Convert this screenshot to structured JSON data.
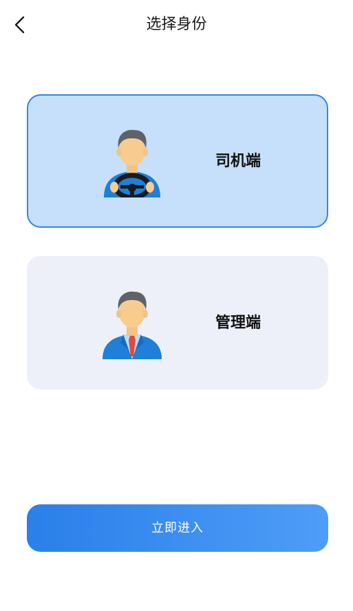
{
  "header": {
    "title": "选择身份",
    "back_icon": "chevron-left-icon"
  },
  "roles": [
    {
      "label": "司机端",
      "icon": "driver-avatar-icon",
      "selected": true
    },
    {
      "label": "管理端",
      "icon": "manager-avatar-icon",
      "selected": false
    }
  ],
  "actions": {
    "enter_label": "立即进入"
  },
  "colors": {
    "accent": "#2f86e8",
    "selected_card_bg": "#c6dffb",
    "card_bg": "#edf0f9",
    "button_gradient_start": "#2a7fe9",
    "button_gradient_end": "#4e9df7"
  }
}
